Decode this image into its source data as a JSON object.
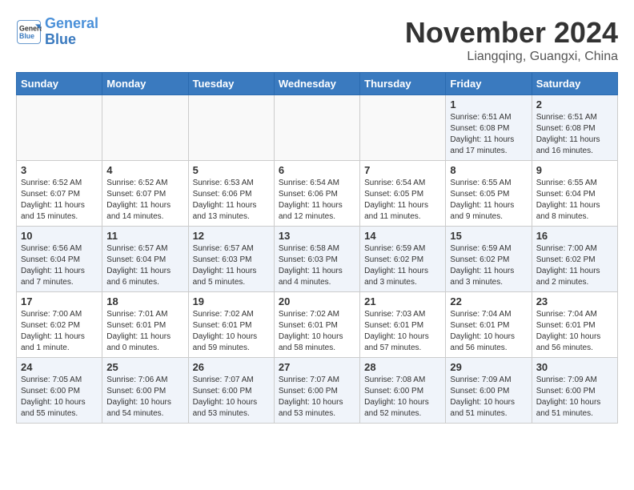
{
  "header": {
    "logo_line1": "General",
    "logo_line2": "Blue",
    "month": "November 2024",
    "location": "Liangqing, Guangxi, China"
  },
  "weekdays": [
    "Sunday",
    "Monday",
    "Tuesday",
    "Wednesday",
    "Thursday",
    "Friday",
    "Saturday"
  ],
  "weeks": [
    [
      {
        "day": "",
        "info": ""
      },
      {
        "day": "",
        "info": ""
      },
      {
        "day": "",
        "info": ""
      },
      {
        "day": "",
        "info": ""
      },
      {
        "day": "",
        "info": ""
      },
      {
        "day": "1",
        "info": "Sunrise: 6:51 AM\nSunset: 6:08 PM\nDaylight: 11 hours\nand 17 minutes."
      },
      {
        "day": "2",
        "info": "Sunrise: 6:51 AM\nSunset: 6:08 PM\nDaylight: 11 hours\nand 16 minutes."
      }
    ],
    [
      {
        "day": "3",
        "info": "Sunrise: 6:52 AM\nSunset: 6:07 PM\nDaylight: 11 hours\nand 15 minutes."
      },
      {
        "day": "4",
        "info": "Sunrise: 6:52 AM\nSunset: 6:07 PM\nDaylight: 11 hours\nand 14 minutes."
      },
      {
        "day": "5",
        "info": "Sunrise: 6:53 AM\nSunset: 6:06 PM\nDaylight: 11 hours\nand 13 minutes."
      },
      {
        "day": "6",
        "info": "Sunrise: 6:54 AM\nSunset: 6:06 PM\nDaylight: 11 hours\nand 12 minutes."
      },
      {
        "day": "7",
        "info": "Sunrise: 6:54 AM\nSunset: 6:05 PM\nDaylight: 11 hours\nand 11 minutes."
      },
      {
        "day": "8",
        "info": "Sunrise: 6:55 AM\nSunset: 6:05 PM\nDaylight: 11 hours\nand 9 minutes."
      },
      {
        "day": "9",
        "info": "Sunrise: 6:55 AM\nSunset: 6:04 PM\nDaylight: 11 hours\nand 8 minutes."
      }
    ],
    [
      {
        "day": "10",
        "info": "Sunrise: 6:56 AM\nSunset: 6:04 PM\nDaylight: 11 hours\nand 7 minutes."
      },
      {
        "day": "11",
        "info": "Sunrise: 6:57 AM\nSunset: 6:04 PM\nDaylight: 11 hours\nand 6 minutes."
      },
      {
        "day": "12",
        "info": "Sunrise: 6:57 AM\nSunset: 6:03 PM\nDaylight: 11 hours\nand 5 minutes."
      },
      {
        "day": "13",
        "info": "Sunrise: 6:58 AM\nSunset: 6:03 PM\nDaylight: 11 hours\nand 4 minutes."
      },
      {
        "day": "14",
        "info": "Sunrise: 6:59 AM\nSunset: 6:02 PM\nDaylight: 11 hours\nand 3 minutes."
      },
      {
        "day": "15",
        "info": "Sunrise: 6:59 AM\nSunset: 6:02 PM\nDaylight: 11 hours\nand 3 minutes."
      },
      {
        "day": "16",
        "info": "Sunrise: 7:00 AM\nSunset: 6:02 PM\nDaylight: 11 hours\nand 2 minutes."
      }
    ],
    [
      {
        "day": "17",
        "info": "Sunrise: 7:00 AM\nSunset: 6:02 PM\nDaylight: 11 hours\nand 1 minute."
      },
      {
        "day": "18",
        "info": "Sunrise: 7:01 AM\nSunset: 6:01 PM\nDaylight: 11 hours\nand 0 minutes."
      },
      {
        "day": "19",
        "info": "Sunrise: 7:02 AM\nSunset: 6:01 PM\nDaylight: 10 hours\nand 59 minutes."
      },
      {
        "day": "20",
        "info": "Sunrise: 7:02 AM\nSunset: 6:01 PM\nDaylight: 10 hours\nand 58 minutes."
      },
      {
        "day": "21",
        "info": "Sunrise: 7:03 AM\nSunset: 6:01 PM\nDaylight: 10 hours\nand 57 minutes."
      },
      {
        "day": "22",
        "info": "Sunrise: 7:04 AM\nSunset: 6:01 PM\nDaylight: 10 hours\nand 56 minutes."
      },
      {
        "day": "23",
        "info": "Sunrise: 7:04 AM\nSunset: 6:01 PM\nDaylight: 10 hours\nand 56 minutes."
      }
    ],
    [
      {
        "day": "24",
        "info": "Sunrise: 7:05 AM\nSunset: 6:00 PM\nDaylight: 10 hours\nand 55 minutes."
      },
      {
        "day": "25",
        "info": "Sunrise: 7:06 AM\nSunset: 6:00 PM\nDaylight: 10 hours\nand 54 minutes."
      },
      {
        "day": "26",
        "info": "Sunrise: 7:07 AM\nSunset: 6:00 PM\nDaylight: 10 hours\nand 53 minutes."
      },
      {
        "day": "27",
        "info": "Sunrise: 7:07 AM\nSunset: 6:00 PM\nDaylight: 10 hours\nand 53 minutes."
      },
      {
        "day": "28",
        "info": "Sunrise: 7:08 AM\nSunset: 6:00 PM\nDaylight: 10 hours\nand 52 minutes."
      },
      {
        "day": "29",
        "info": "Sunrise: 7:09 AM\nSunset: 6:00 PM\nDaylight: 10 hours\nand 51 minutes."
      },
      {
        "day": "30",
        "info": "Sunrise: 7:09 AM\nSunset: 6:00 PM\nDaylight: 10 hours\nand 51 minutes."
      }
    ]
  ]
}
